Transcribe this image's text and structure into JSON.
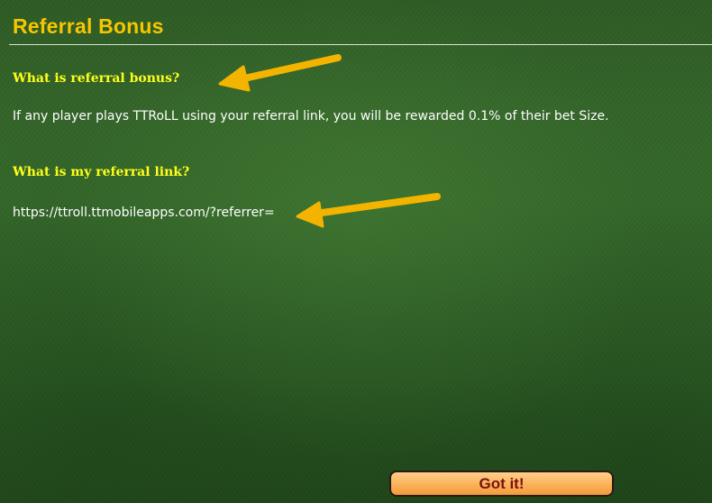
{
  "header": {
    "title": "Referral Bonus"
  },
  "sections": [
    {
      "question": "What is referral bonus?",
      "answer": "If any player plays TTRoLL using your referral link, you will be rewarded 0.1% of their bet Size."
    },
    {
      "question": "What is my referral link?",
      "answer": "https://ttroll.ttmobileapps.com/?referrer="
    }
  ],
  "actions": {
    "confirm_label": "Got it!"
  },
  "colors": {
    "title": "#f7c600",
    "question": "#ffff1a",
    "body_text": "#ffffff",
    "arrow": "#f3b400",
    "button_text": "#7a1010"
  },
  "icons": {
    "annotation_arrow": "arrow-left-icon"
  }
}
